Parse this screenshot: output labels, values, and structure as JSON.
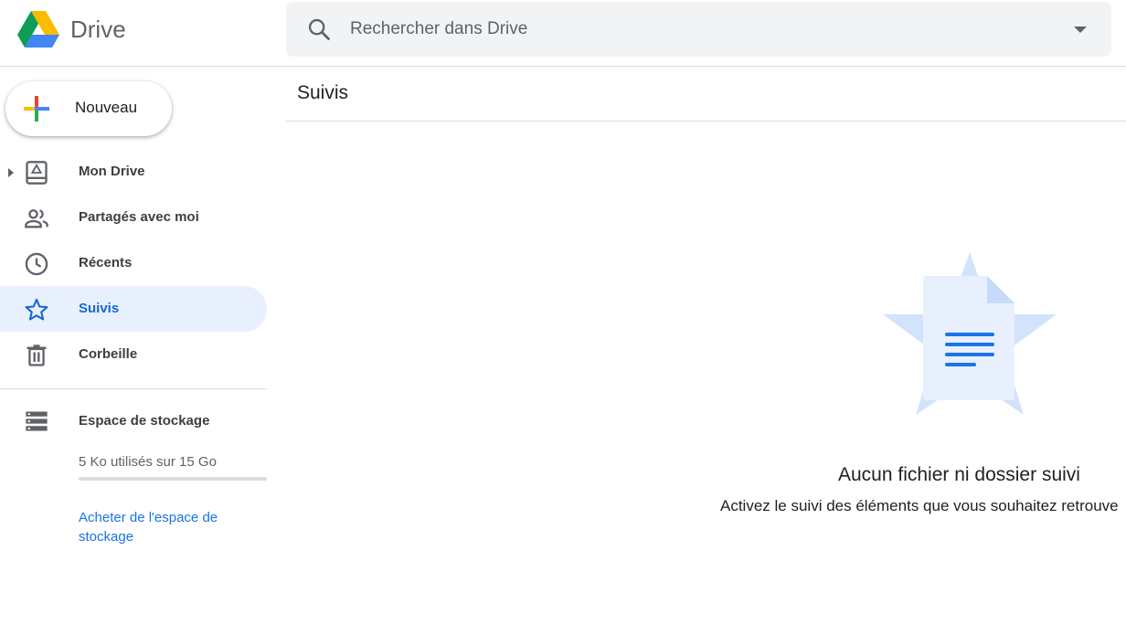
{
  "app": {
    "name": "Drive"
  },
  "search": {
    "placeholder": "Rechercher dans Drive",
    "value": ""
  },
  "new_button": {
    "label": "Nouveau"
  },
  "sidebar": {
    "items": [
      {
        "label": "Mon Drive",
        "icon": "my-drive-icon",
        "active": false
      },
      {
        "label": "Partagés avec moi",
        "icon": "people-icon",
        "active": false
      },
      {
        "label": "Récents",
        "icon": "clock-icon",
        "active": false
      },
      {
        "label": "Suivis",
        "icon": "star-icon",
        "active": true
      },
      {
        "label": "Corbeille",
        "icon": "trash-icon",
        "active": false
      }
    ],
    "storage": {
      "title": "Espace de stockage",
      "usage": "5 Ko utilisés sur 15 Go",
      "used_fraction": 3e-07,
      "buy_link": "Acheter de l'espace de stockage"
    }
  },
  "main": {
    "title": "Suivis",
    "empty_state": {
      "title": "Aucun fichier ni dossier suivi",
      "subtitle": "Activez le suivi des éléments que vous souhaitez retrouve"
    }
  },
  "colors": {
    "accent": "#1a73e8",
    "active_bg": "#e8f0fe",
    "active_text": "#1967d2",
    "search_bg": "#f1f3f4",
    "divider": "#dadce0"
  }
}
